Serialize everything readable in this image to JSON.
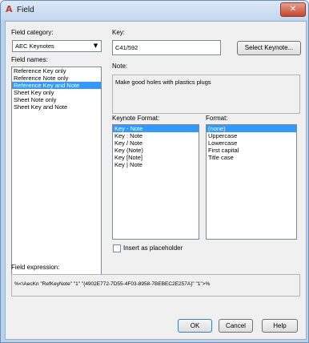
{
  "window": {
    "title": "Field"
  },
  "field_category": {
    "label": "Field category:",
    "value": "AEC Keynotes"
  },
  "field_names": {
    "label": "Field names:",
    "items": [
      "Reference Key only",
      "Reference Note only",
      "Reference Key and Note",
      "Sheet Key only",
      "Sheet Note only",
      "Sheet Key and Note"
    ],
    "selected": 2
  },
  "key": {
    "label": "Key:",
    "value": "C41/592",
    "select_button": "Select Keynote..."
  },
  "note": {
    "label": "Note:",
    "value": "Make good holes with plastics plugs"
  },
  "keynote_format": {
    "label": "Keynote Format:",
    "items": [
      "Key - Note",
      "Key : Note",
      "Key / Note",
      "Key (Note)",
      "Key [Note]",
      "Key | Note"
    ],
    "selected": 0
  },
  "format": {
    "label": "Format:",
    "items": [
      "(none)",
      "Uppercase",
      "Lowercase",
      "First capital",
      "Title case"
    ],
    "selected": 0
  },
  "placeholder": {
    "label": "Insert as placeholder",
    "checked": false
  },
  "field_expression": {
    "label": "Field expression:",
    "value": "%<\\AecKn \"RefKeyNote\" \"1\" \"{4902E772-7D55-4F03-8958-7BEBEC2E257A}\" \"1\">%"
  },
  "buttons": {
    "ok": "OK",
    "cancel": "Cancel",
    "help": "Help"
  }
}
